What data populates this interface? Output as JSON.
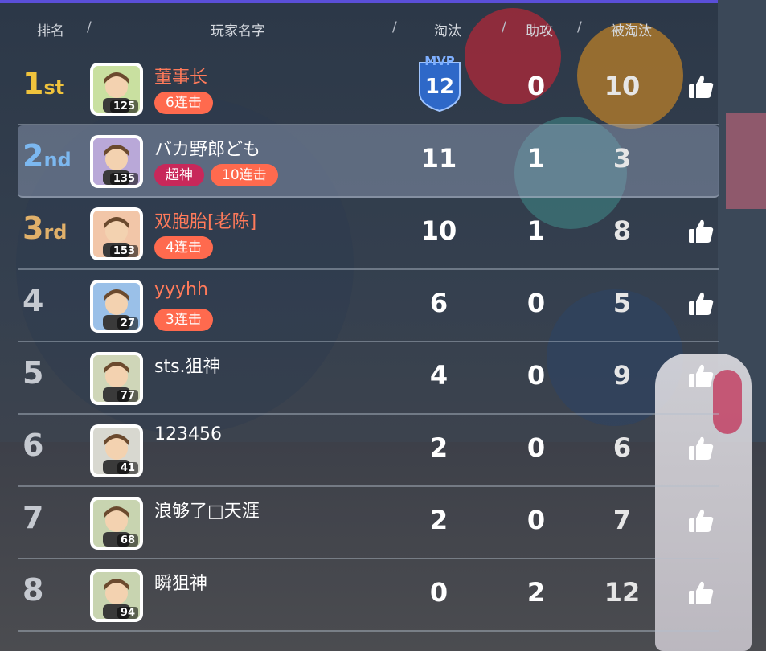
{
  "header": {
    "rank": "排名",
    "name": "玩家名字",
    "kills": "淘汰",
    "assists": "助攻",
    "deaths": "被淘汰",
    "sep": "/"
  },
  "colors": {
    "gold": "#f0c33c",
    "silver_blue": "#7cb8f0",
    "bronze": "#e0b06a",
    "streak": "#ff6a4e",
    "godlike": "#c8285a",
    "mvp_blue": "#2e68c8"
  },
  "mvp": {
    "label": "MVP",
    "value": "12"
  },
  "players": [
    {
      "rank_num": "1",
      "rank_suffix": "st",
      "name": "董事长",
      "level": "125",
      "tags": [
        "6连击"
      ],
      "kills": "",
      "assists": "0",
      "deaths": "10",
      "mvp": true,
      "highlight": false,
      "like_icon": "thumbs-up-icon"
    },
    {
      "rank_num": "2",
      "rank_suffix": "nd",
      "name": "バカ野郎ども",
      "level": "135",
      "tags": [
        "超神",
        "10连击"
      ],
      "kills": "11",
      "assists": "1",
      "deaths": "3",
      "mvp": false,
      "highlight": true,
      "like_icon": ""
    },
    {
      "rank_num": "3",
      "rank_suffix": "rd",
      "name": "双胞胎[老陈]",
      "level": "153",
      "tags": [
        "4连击"
      ],
      "kills": "10",
      "assists": "1",
      "deaths": "8",
      "mvp": false,
      "highlight": false,
      "like_icon": "thumbs-up-icon"
    },
    {
      "rank_num": "4",
      "rank_suffix": "",
      "name": "yyyhh",
      "level": "27",
      "tags": [
        "3连击"
      ],
      "kills": "6",
      "assists": "0",
      "deaths": "5",
      "mvp": false,
      "highlight": false,
      "like_icon": "thumbs-up-icon"
    },
    {
      "rank_num": "5",
      "rank_suffix": "",
      "name": "sts.狙神",
      "level": "77",
      "tags": [],
      "kills": "4",
      "assists": "0",
      "deaths": "9",
      "mvp": false,
      "highlight": false,
      "like_icon": "thumbs-up-icon"
    },
    {
      "rank_num": "6",
      "rank_suffix": "",
      "name": "123456",
      "level": "41",
      "tags": [],
      "kills": "2",
      "assists": "0",
      "deaths": "6",
      "mvp": false,
      "highlight": false,
      "like_icon": "thumbs-up-icon"
    },
    {
      "rank_num": "7",
      "rank_suffix": "",
      "name": "浪够了□天涯",
      "level": "68",
      "tags": [],
      "kills": "2",
      "assists": "0",
      "deaths": "7",
      "mvp": false,
      "highlight": false,
      "like_icon": "thumbs-up-icon"
    },
    {
      "rank_num": "8",
      "rank_suffix": "",
      "name": "瞬狙神",
      "level": "94",
      "tags": [],
      "kills": "0",
      "assists": "2",
      "deaths": "12",
      "mvp": false,
      "highlight": false,
      "like_icon": "thumbs-up-icon"
    }
  ]
}
